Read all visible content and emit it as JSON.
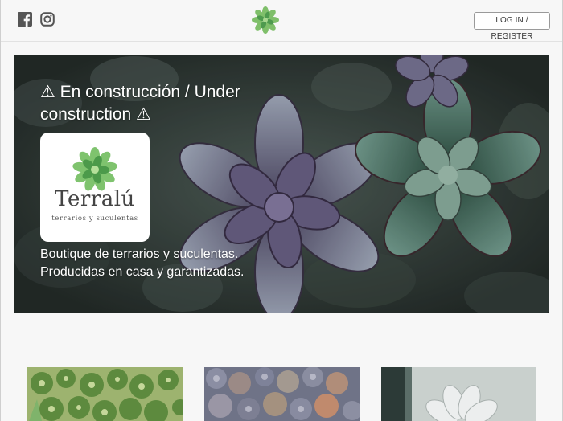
{
  "header": {
    "social": [
      "facebook-icon",
      "instagram-icon"
    ],
    "logo_icon": "succulent-logo-icon",
    "login_label": "LOG IN / REGISTER"
  },
  "hero": {
    "title": "⚠ En construcción / Under construction ⚠",
    "logo": {
      "wordmark": "Terralú",
      "tagline": "terrarios y suculentas"
    },
    "description": [
      "Boutique de terrarios y suculentas.",
      "Producidas en casa y garantizadas."
    ]
  },
  "cards": [
    {
      "image": "cactus-photo"
    },
    {
      "image": "succulents-photo"
    },
    {
      "image": "pale-succulent-photo"
    }
  ],
  "colors": {
    "background": "#f7f7f7",
    "succulent_green": "#6aa86a",
    "hero_dark": "#33403a"
  }
}
